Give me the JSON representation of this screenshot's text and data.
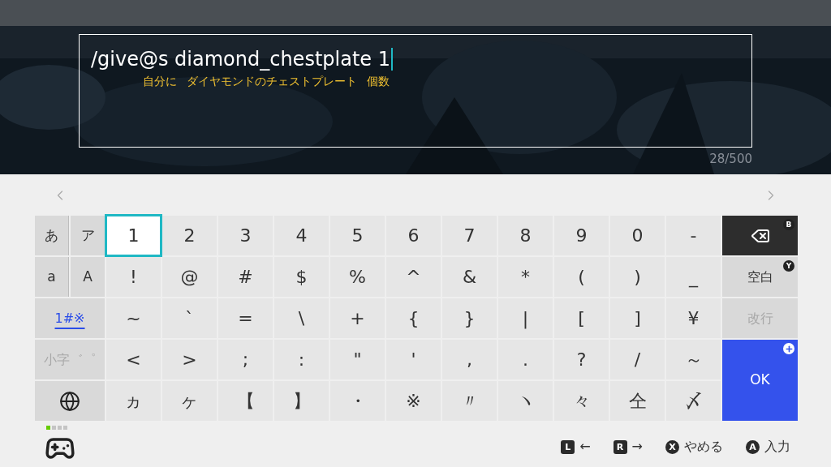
{
  "input": {
    "value": "/give@s diamond_chestplate 1",
    "annotations": [
      "自分に",
      "ダイヤモンドのチェストプレート",
      "個数"
    ]
  },
  "counter": "28/500",
  "mode_keys": [
    {
      "kind": "pair",
      "items": [
        {
          "label": "あ",
          "selected": false
        },
        {
          "label": "ア",
          "selected": false
        }
      ]
    },
    {
      "kind": "pair",
      "items": [
        {
          "label": "a",
          "selected": false
        },
        {
          "label": "A",
          "selected": false
        }
      ]
    },
    {
      "kind": "single",
      "label": "1#※",
      "selected": true
    },
    {
      "kind": "single",
      "label": "小字゛゜",
      "selected": false,
      "disabled": true
    },
    {
      "kind": "globe"
    }
  ],
  "keys": [
    [
      {
        "label": "1",
        "focused": true
      },
      {
        "label": "2",
        "focused": false
      },
      {
        "label": "3",
        "focused": false
      },
      {
        "label": "4",
        "focused": false
      },
      {
        "label": "5",
        "focused": false
      },
      {
        "label": "6",
        "focused": false
      },
      {
        "label": "7",
        "focused": false
      },
      {
        "label": "8",
        "focused": false
      },
      {
        "label": "9",
        "focused": false
      },
      {
        "label": "0",
        "focused": false
      },
      {
        "label": "-",
        "focused": false
      }
    ],
    [
      {
        "label": "!",
        "focused": false
      },
      {
        "label": "@",
        "focused": false
      },
      {
        "label": "#",
        "focused": false
      },
      {
        "label": "$",
        "focused": false
      },
      {
        "label": "%",
        "focused": false
      },
      {
        "label": "^",
        "focused": false
      },
      {
        "label": "&",
        "focused": false
      },
      {
        "label": "*",
        "focused": false
      },
      {
        "label": "(",
        "focused": false
      },
      {
        "label": ")",
        "focused": false
      },
      {
        "label": "_",
        "focused": false
      }
    ],
    [
      {
        "label": "~",
        "focused": false
      },
      {
        "label": "`",
        "focused": false
      },
      {
        "label": "=",
        "focused": false
      },
      {
        "label": "\\",
        "focused": false
      },
      {
        "label": "+",
        "focused": false
      },
      {
        "label": "{",
        "focused": false
      },
      {
        "label": "}",
        "focused": false
      },
      {
        "label": "|",
        "focused": false
      },
      {
        "label": "[",
        "focused": false
      },
      {
        "label": "]",
        "focused": false
      },
      {
        "label": "¥",
        "focused": false
      }
    ],
    [
      {
        "label": "<",
        "focused": false
      },
      {
        "label": ">",
        "focused": false
      },
      {
        "label": ";",
        "focused": false
      },
      {
        "label": ":",
        "focused": false
      },
      {
        "label": "\"",
        "focused": false
      },
      {
        "label": "'",
        "focused": false
      },
      {
        "label": ",",
        "focused": false
      },
      {
        "label": ".",
        "focused": false
      },
      {
        "label": "?",
        "focused": false
      },
      {
        "label": "/",
        "focused": false
      },
      {
        "label": "～",
        "focused": false
      }
    ],
    [
      {
        "label": "ヵ",
        "focused": false
      },
      {
        "label": "ヶ",
        "focused": false
      },
      {
        "label": "【",
        "focused": false
      },
      {
        "label": "】",
        "focused": false
      },
      {
        "label": "・",
        "focused": false
      },
      {
        "label": "※",
        "focused": false
      },
      {
        "label": "〃",
        "focused": false
      },
      {
        "label": "ヽ",
        "focused": false
      },
      {
        "label": "々",
        "focused": false
      },
      {
        "label": "仝",
        "focused": false
      },
      {
        "label": "〆",
        "focused": false
      }
    ]
  ],
  "action_keys": [
    {
      "kind": "backspace",
      "badge": "B",
      "disabled": false
    },
    {
      "kind": "space",
      "label": "空白",
      "badge": "Y",
      "disabled": false
    },
    {
      "kind": "newline",
      "label": "改行",
      "disabled": true
    },
    {
      "kind": "ok",
      "label": "OK",
      "disabled": false
    }
  ],
  "page_dots": [
    {
      "selected": true
    },
    {
      "selected": false
    },
    {
      "selected": false
    },
    {
      "selected": false
    }
  ],
  "hints": [
    {
      "kind": "shoulder",
      "button": "L",
      "label": "←"
    },
    {
      "kind": "shoulder",
      "button": "R",
      "label": "→"
    },
    {
      "kind": "face",
      "button": "X",
      "label": "やめる"
    },
    {
      "kind": "face",
      "button": "A",
      "label": "入力"
    }
  ]
}
